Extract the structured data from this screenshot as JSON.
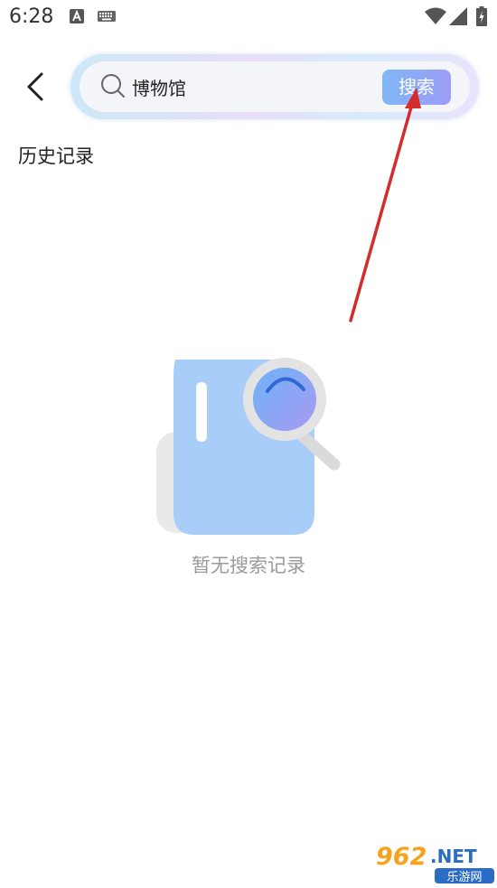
{
  "status_bar": {
    "time": "6:28",
    "icons": [
      "a-icon",
      "keyboard-icon",
      "wifi-icon",
      "signal-icon",
      "battery-icon"
    ]
  },
  "header": {
    "back_icon": "chevron-left-icon",
    "search": {
      "value": "博物馆",
      "icon": "search-icon"
    },
    "search_button_label": "搜索"
  },
  "history": {
    "title": "历史记录",
    "empty_text": "暂无搜索记录"
  },
  "watermark": {
    "brand": "962.NET",
    "subtitle": "乐游网"
  },
  "colors": {
    "accent_start": "#7fb7f7",
    "accent_end": "#9d9cf5",
    "illustration_blue": "#a9cdf9",
    "arrow_red": "#d42b2b"
  }
}
